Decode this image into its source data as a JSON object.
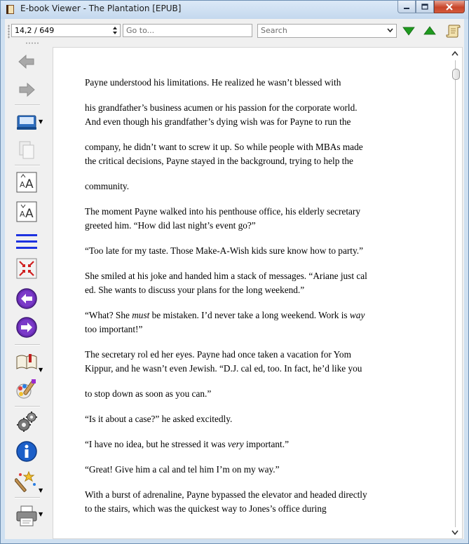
{
  "window": {
    "title": "E-book Viewer - The Plantation [EPUB]"
  },
  "toolbar": {
    "position_value": "14,2 / 649",
    "goto_placeholder": "Go to...",
    "search_placeholder": "Search"
  },
  "colors": {
    "accent_green": "#1f9a1f",
    "nav_blue": "#2b3bd6",
    "frame_blue": "#cfe0f1"
  },
  "sidebar": {
    "items": [
      {
        "name": "back-icon"
      },
      {
        "name": "forward-icon"
      },
      {
        "name": "open-ebook-icon"
      },
      {
        "name": "copy-icon"
      },
      {
        "name": "font-larger-icon"
      },
      {
        "name": "font-smaller-icon"
      },
      {
        "name": "table-of-contents-icon"
      },
      {
        "name": "fullscreen-icon"
      },
      {
        "name": "previous-page-icon"
      },
      {
        "name": "next-page-icon"
      },
      {
        "name": "bookmarks-icon"
      },
      {
        "name": "reference-mode-icon"
      },
      {
        "name": "preferences-icon"
      },
      {
        "name": "metadata-info-icon"
      },
      {
        "name": "load-theme-icon"
      },
      {
        "name": "print-icon"
      }
    ]
  },
  "content": {
    "paragraphs": [
      "Payne understood his limitations. He realized he wasn’t blessed with",
      "his grandfather’s business acumen or his passion for the corporate world.",
      "And even though his grandfather’s dying wish was for Payne to run the",
      "company, he didn’t want to screw it up. So while people with MBAs made",
      "the critical decisions, Payne stayed in the background, trying to help the",
      "community.",
      "The moment Payne walked into his penthouse office, his elderly secretary",
      "greeted him. “How did last night’s event go?”",
      "“Too late for my taste. Those Make-A-Wish kids sure know how to party.”",
      "She smiled at his joke and handed him a stack of messages. “Ariane just cal",
      "ed. She wants to discuss your plans for the long weekend.”",
      "“What? She ",
      "must",
      " be mistaken. I’d never take a long weekend. Work is ",
      "way",
      "too important!”",
      "The secretary rol ed her eyes. Payne had once taken a vacation for Yom",
      "Kippur, and he wasn’t even Jewish. “D.J. cal ed, too. In fact, he’d like you",
      "to stop down as soon as you can.”",
      "“Is it about a case?” he asked excitedly.",
      "“I have no idea, but he stressed it was ",
      "very",
      " important.”",
      "“Great! Give him a cal and tel him I’m on my way.”",
      "With a burst of adrenaline, Payne bypassed the elevator and headed directly",
      "to the stairs, which was the quickest way to Jones’s office during"
    ]
  }
}
